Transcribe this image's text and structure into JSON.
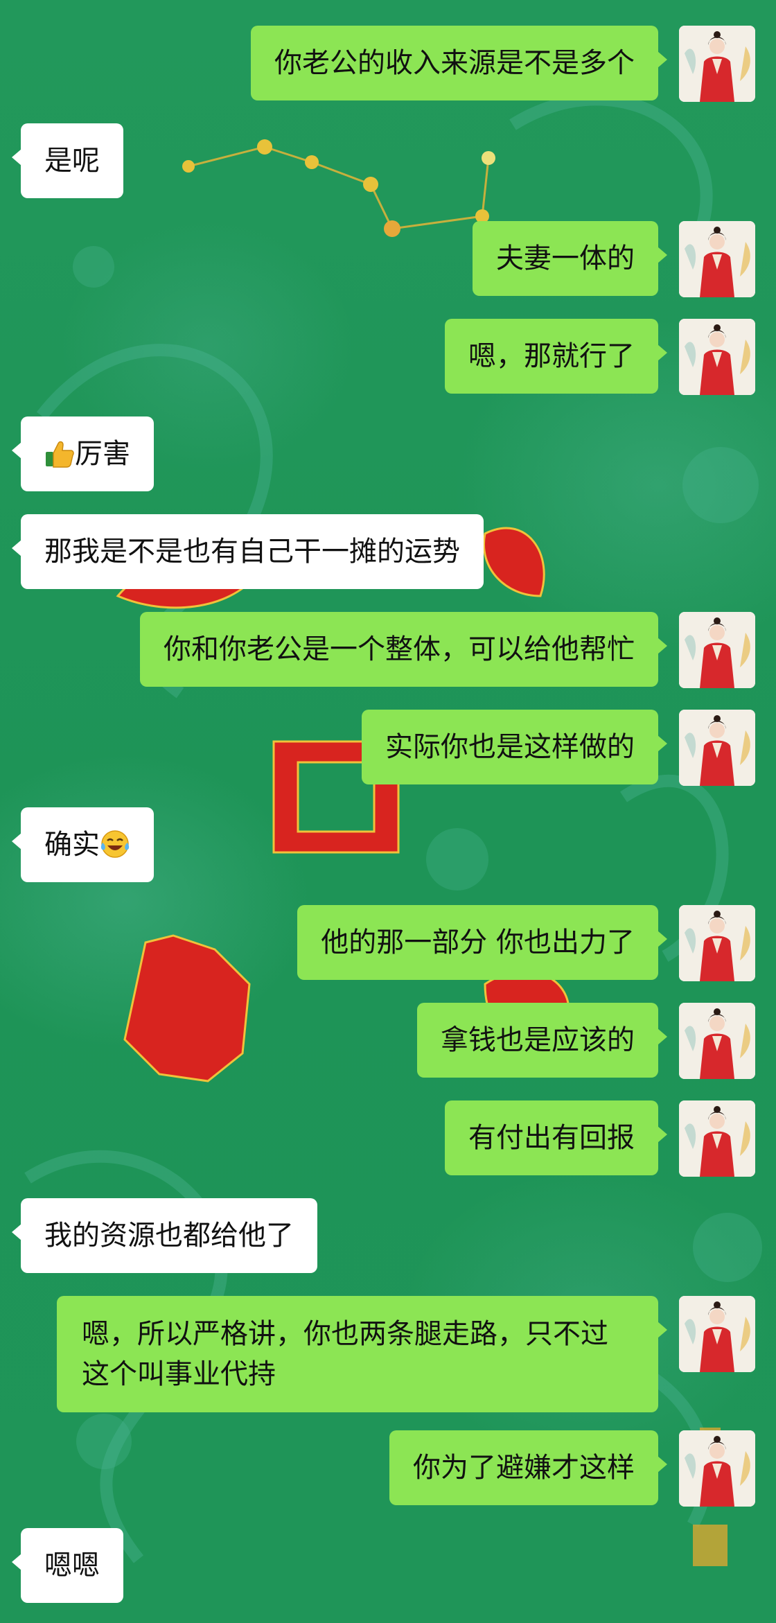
{
  "chat": {
    "messages": [
      {
        "side": "out",
        "text": "你老公的收入来源是不是多个"
      },
      {
        "side": "in",
        "text": "是呢"
      },
      {
        "side": "out",
        "text": "夫妻一体的"
      },
      {
        "side": "out",
        "text": "嗯，那就行了"
      },
      {
        "side": "in",
        "emoji": "thumbs-up-icon",
        "text": "厉害"
      },
      {
        "side": "in",
        "text": "那我是不是也有自己干一摊的运势"
      },
      {
        "side": "out",
        "text": "你和你老公是一个整体，可以给他帮忙"
      },
      {
        "side": "out",
        "text": "实际你也是这样做的"
      },
      {
        "side": "in",
        "text": "确实",
        "emoji_after": "laughing-tears-icon"
      },
      {
        "side": "out",
        "text": "他的那一部分 你也出力了"
      },
      {
        "side": "out",
        "text": "拿钱也是应该的"
      },
      {
        "side": "out",
        "text": "有付出有回报"
      },
      {
        "side": "in",
        "text": "我的资源也都给他了"
      },
      {
        "side": "out",
        "text": "嗯，所以严格讲，你也两条腿走路，只不过这个叫事业代持"
      },
      {
        "side": "out",
        "text": "你为了避嫌才这样"
      },
      {
        "side": "in",
        "text": "嗯嗯"
      }
    ]
  },
  "colors": {
    "background": "#1f9659",
    "outgoing_bubble": "#8ce554",
    "incoming_bubble": "#ffffff"
  }
}
